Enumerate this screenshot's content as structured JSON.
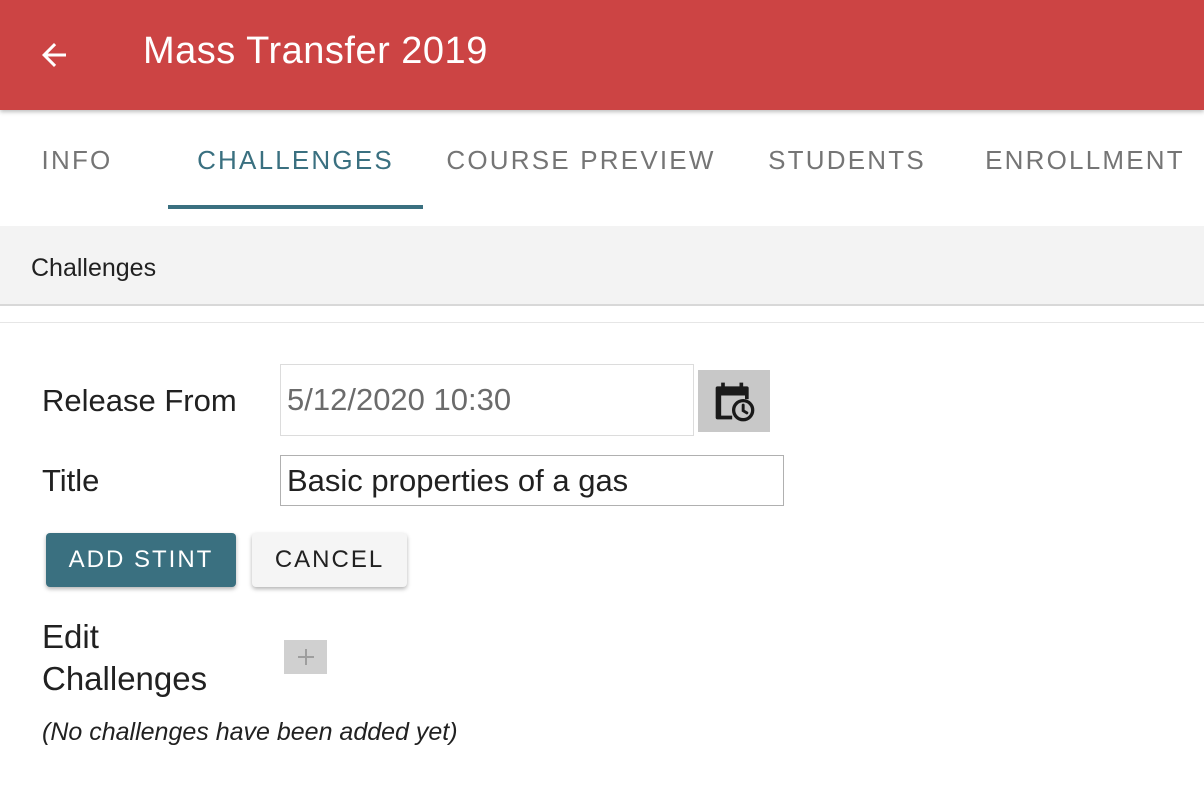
{
  "appbar": {
    "title": "Mass Transfer 2019",
    "back_icon": "arrow-back-icon",
    "background": "#cc4444"
  },
  "tabs": [
    {
      "label": "INFO",
      "active": false
    },
    {
      "label": "CHALLENGES",
      "active": true
    },
    {
      "label": "COURSE PREVIEW",
      "active": false
    },
    {
      "label": "STUDENTS",
      "active": false
    },
    {
      "label": "ENROLLMENT",
      "active": false
    }
  ],
  "accent": "#3a7080",
  "section": {
    "header": "Challenges"
  },
  "form": {
    "release_label": "Release From",
    "release_value": "5/12/2020 10:30",
    "calendar_icon": "calendar-clock-icon",
    "title_label": "Title",
    "title_value": "Basic properties of a gas",
    "add_stint_label": "ADD STINT",
    "cancel_label": "CANCEL"
  },
  "challenges": {
    "heading": "Edit Challenges",
    "add_icon": "plus-icon",
    "empty_text": "(No challenges have been added yet)"
  }
}
